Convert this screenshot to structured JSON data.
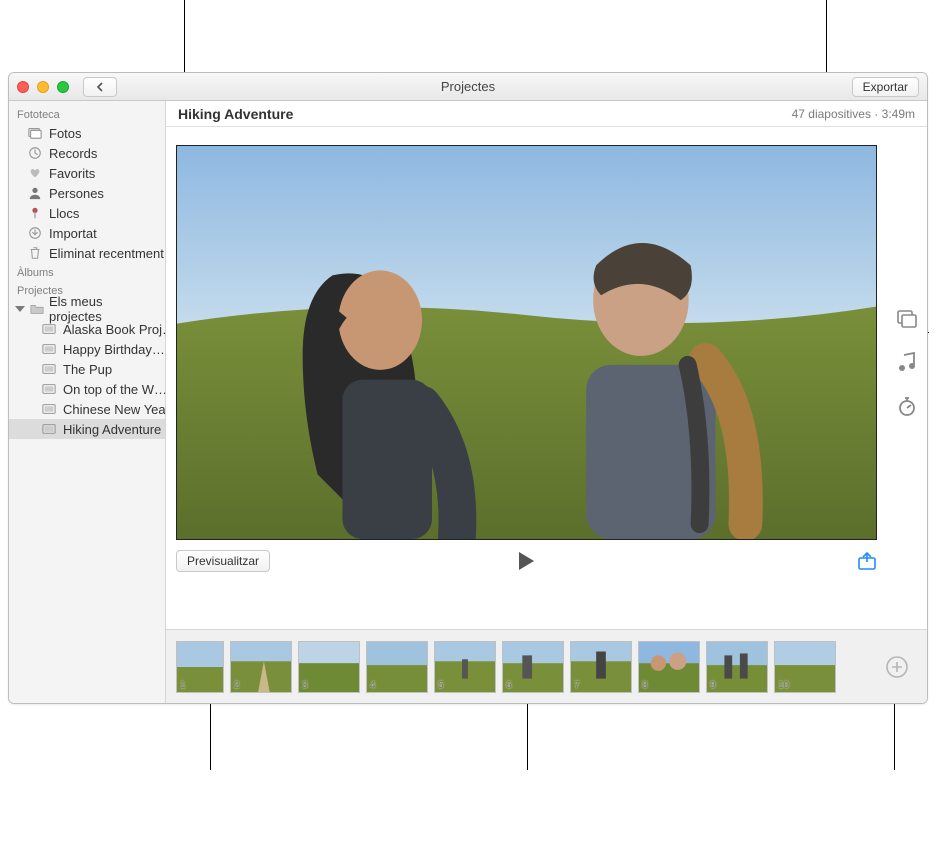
{
  "window": {
    "title": "Projectes",
    "export": "Exportar"
  },
  "sidebar": {
    "section_library": "Fototeca",
    "library": [
      {
        "label": "Fotos",
        "icon": "photos"
      },
      {
        "label": "Records",
        "icon": "clock"
      },
      {
        "label": "Favorits",
        "icon": "heart"
      },
      {
        "label": "Persones",
        "icon": "person"
      },
      {
        "label": "Llocs",
        "icon": "pin"
      },
      {
        "label": "Importat",
        "icon": "import"
      },
      {
        "label": "Eliminat recentment",
        "icon": "trash"
      }
    ],
    "section_albums": "Àlbums",
    "section_projects": "Projectes",
    "projects_folder": "Els meus projectes",
    "projects": [
      {
        "label": "Alaska Book Proj…"
      },
      {
        "label": "Happy Birthday…"
      },
      {
        "label": "The Pup"
      },
      {
        "label": "On top of the W…"
      },
      {
        "label": "Chinese New Year"
      },
      {
        "label": "Hiking Adventure",
        "selected": true
      }
    ]
  },
  "project": {
    "title": "Hiking Adventure",
    "meta": "47 diapositives · 3:49m",
    "preview_button": "Previsualitzar"
  },
  "thumbnails": [
    "1",
    "2",
    "3",
    "4",
    "5",
    "6",
    "7",
    "8",
    "9",
    "10"
  ]
}
